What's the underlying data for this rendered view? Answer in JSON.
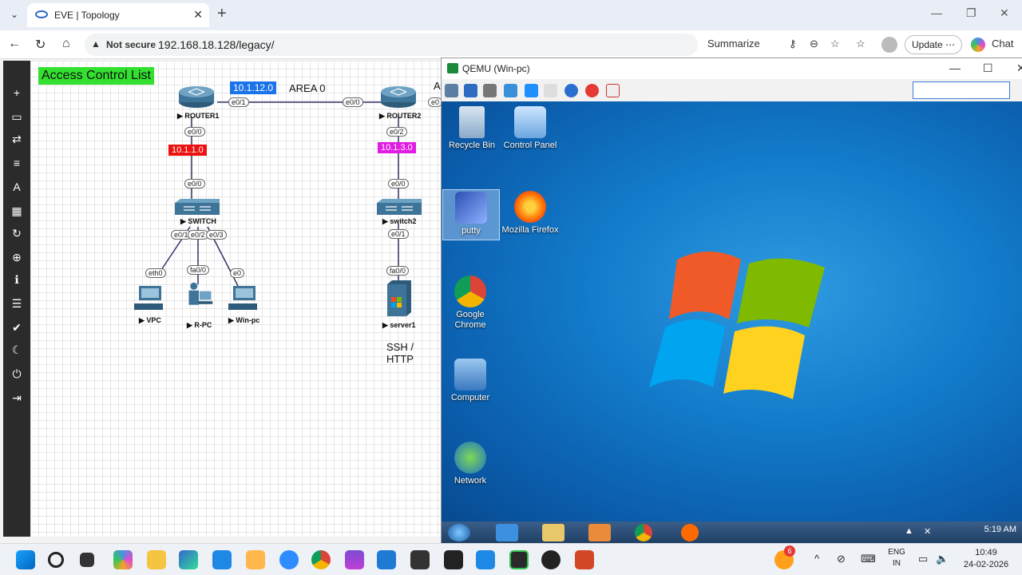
{
  "browser": {
    "tab_title": "EVE | Topology",
    "security_label": "Not secure",
    "url": "192.168.18.128/legacy/",
    "summarize_label": "Summarize",
    "update_label": "Update ⋯",
    "chat_label": "Chat"
  },
  "topology": {
    "heading": "Access Control List",
    "area_label": "AREA 0",
    "area_label_2": "A",
    "bottom_text": "SSH / HTTP",
    "networks": [
      {
        "label": "10.1.12.0",
        "color": "#1a73e8"
      },
      {
        "label": "10.1.1.0",
        "color": "#ee1111"
      },
      {
        "label": "10.1.3.0",
        "color": "#e21be2"
      }
    ],
    "devices": {
      "router1": "ROUTER1",
      "router2": "ROUTER2",
      "switch1": "SWITCH",
      "switch2": "switch2",
      "vpc": "VPC",
      "rpc": "R-PC",
      "winpc": "Win-pc",
      "server1": "server1"
    },
    "ports": {
      "r1_e01": "e0/1",
      "r2_e00": "e0/0",
      "r2_e01": "e0",
      "r1_e00": "e0/0",
      "sw1_e00": "e0/0",
      "r2_e02": "e0/2",
      "sw2_e00": "e0/0",
      "sw1_e01": "e0/1",
      "sw1_e02": "e0/2",
      "sw1_e03": "e0/3",
      "vpc_eth0": "eth0",
      "rpc_fa00": "fa0/0",
      "winpc_e0": "e0",
      "sw2_e01": "e0/1",
      "srv_fa00": "fa0/0"
    }
  },
  "qemu": {
    "title": "QEMU (Win-pc)",
    "desktop_icons": [
      {
        "label": "Recycle Bin"
      },
      {
        "label": "Control Panel"
      },
      {
        "label": "putty"
      },
      {
        "label": "Mozilla Firefox"
      },
      {
        "label": "Google Chrome"
      },
      {
        "label": "Computer"
      },
      {
        "label": "Network"
      }
    ],
    "clock_time": "5:19 AM"
  },
  "taskbar": {
    "lang_top": "ENG",
    "lang_bottom": "IN",
    "time": "10:49",
    "date": "24-02-2026",
    "badge": "6"
  }
}
